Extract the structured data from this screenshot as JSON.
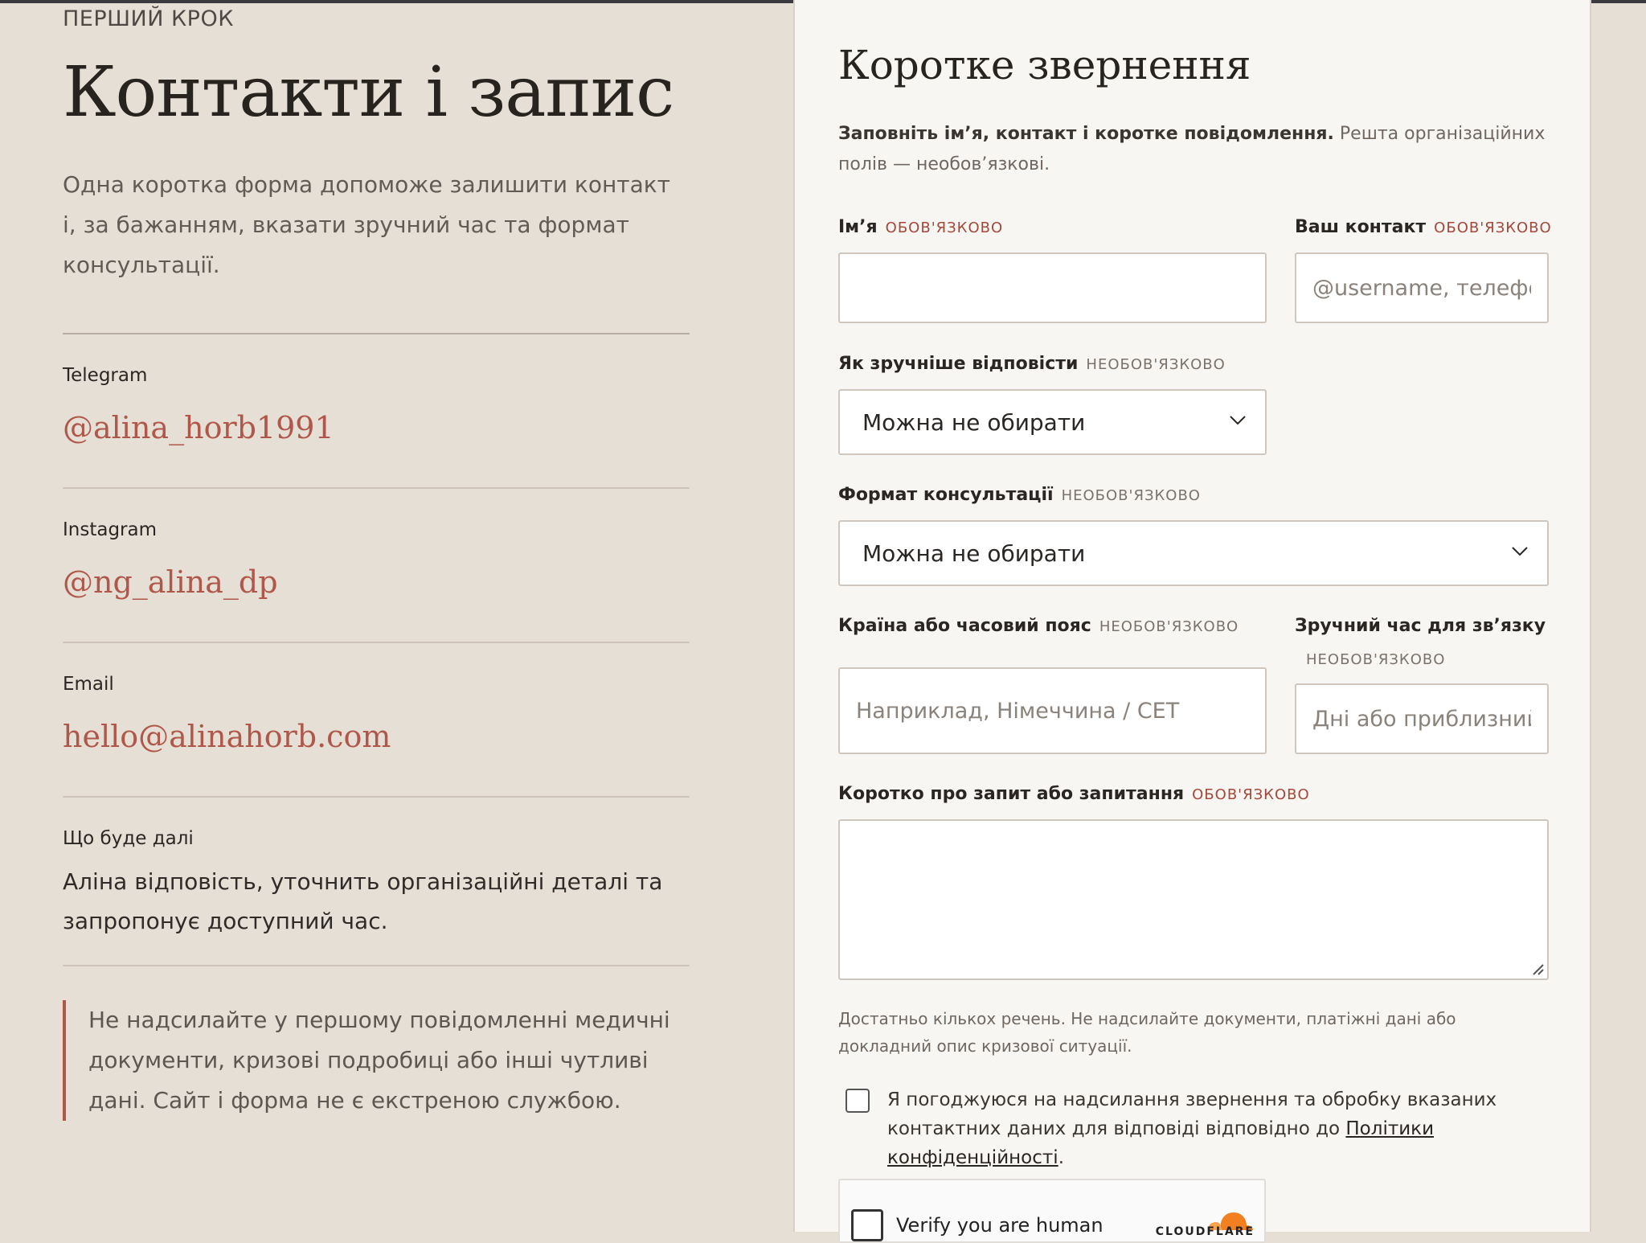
{
  "left": {
    "eyebrow": "ПЕРШИЙ КРОК",
    "title": "Контакти і запис",
    "intro": "Одна коротка форма допоможе залишити контакт і, за бажанням, вказати зручний час та формат консультації.",
    "contacts": [
      {
        "label": "Telegram",
        "value": "@alina_horb1991"
      },
      {
        "label": "Instagram",
        "value": "@ng_alina_dp"
      },
      {
        "label": "Email",
        "value": "hello@alinahorb.com"
      }
    ],
    "next": {
      "label": "Що буде далі",
      "text": "Аліна відповість, уточнить організаційні деталі та запропонує доступний час."
    },
    "notice": "Не надсилайте у першому повідомленні медичні документи, кризові подробиці або інші чутливі дані. Сайт і форма не є екстреною службою."
  },
  "form": {
    "title": "Коротке звернення",
    "desc_bold": "Заповніть ім’я, контакт і коротке повідомлення.",
    "desc_rest": " Решта організаційних полів — необов’язкові.",
    "required_tag": "ОБОВ'ЯЗКОВО",
    "optional_tag": "НЕОБОВ'ЯЗКОВО",
    "name_label": "Ім’я",
    "name_value": "",
    "contact_label": "Ваш контакт",
    "contact_placeholder": "@username, телефон або email",
    "reply_label": "Як зручніше відповісти",
    "reply_selected": "Можна не обирати",
    "format_label": "Формат консультації",
    "format_selected": "Можна не обирати",
    "country_label": "Країна або часовий пояс",
    "country_placeholder": "Наприклад, Німеччина / CET",
    "time_label": "Зручний час для зв’язку",
    "time_placeholder": "Дні або приблизний час",
    "message_label": "Коротко про запит або запитання",
    "message_value": "",
    "hint": "Достатньо кількох речень. Не надсилайте документи, платіжні дані або докладний опис кризової ситуації.",
    "consent_text": "Я погоджуюся на надсилання звернення та обробку вказаних контактних даних для відповіді відповідно до ",
    "consent_link": "Політики конфіденційності",
    "consent_end": ".",
    "captcha_text": "Verify you are human",
    "captcha_brand": "CLOUDFLARE"
  },
  "colors": {
    "page_bg": "#e6dfd6",
    "panel_bg": "#f8f6f2",
    "accent": "#b0574a",
    "required": "#a5473a",
    "text": "#2a2623"
  },
  "icons": [
    "chevron-down-icon",
    "resize-grip-icon",
    "cloudflare-logo-icon"
  ]
}
